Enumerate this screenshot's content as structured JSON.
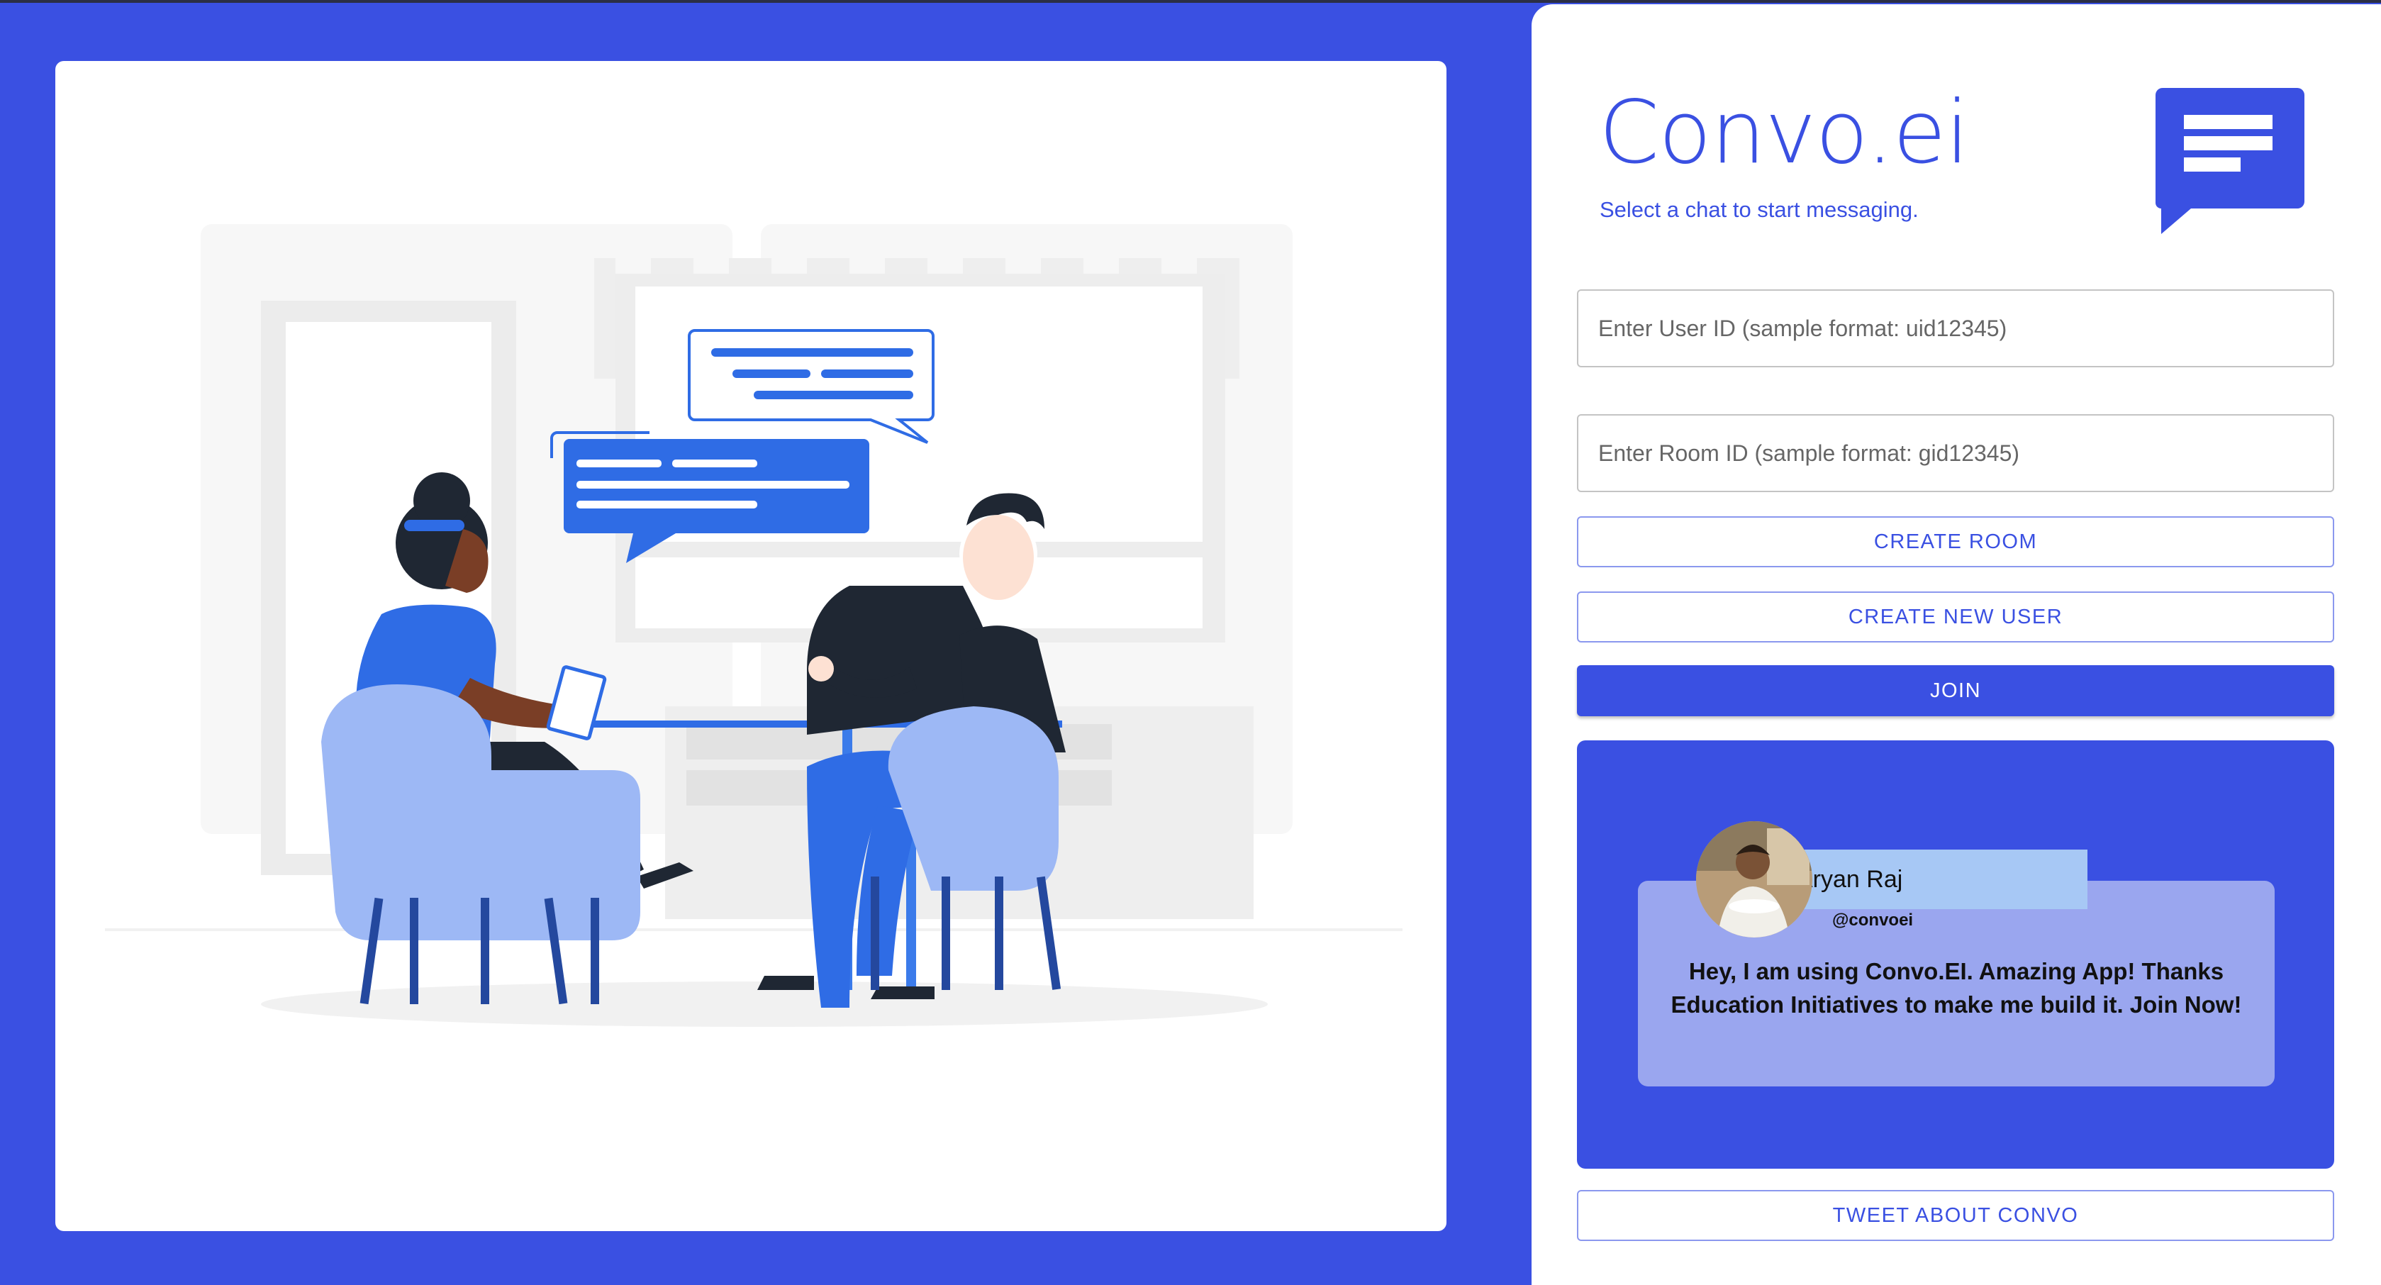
{
  "app": {
    "title": "Convo.ei",
    "subtitle": "Select a chat to start messaging."
  },
  "form": {
    "user_id_placeholder": "Enter User ID (sample format: uid12345)",
    "room_id_placeholder": "Enter Room ID (sample format: gid12345)",
    "create_room_label": "CREATE ROOM",
    "create_user_label": "CREATE NEW USER",
    "join_label": "JOIN"
  },
  "testimonial": {
    "name": "Aryan Raj",
    "handle": "@convoei",
    "text": "Hey, I am using Convo.EI. Amazing App! Thanks Education Initiatives to make me build it. Join Now!"
  },
  "footer": {
    "tweet_label": "TWEET ABOUT CONVO"
  },
  "icons": {
    "logo": "chat-bubble-icon"
  },
  "colors": {
    "brand": "#3a50e2",
    "card_tint": "#9aa6ef",
    "name_tag": "#a7c8f5"
  }
}
